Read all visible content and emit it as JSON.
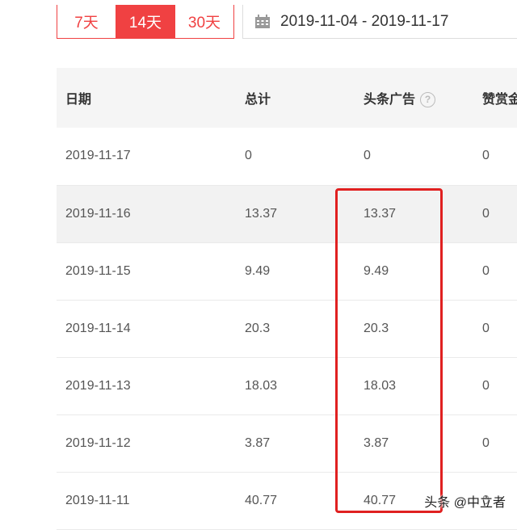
{
  "range_buttons": [
    {
      "label": "7天",
      "active": false
    },
    {
      "label": "14天",
      "active": true
    },
    {
      "label": "30天",
      "active": false
    }
  ],
  "date_range": {
    "icon": "calendar-icon",
    "value": "2019-11-04 - 2019-11-17"
  },
  "table": {
    "headers": [
      "日期",
      "总计",
      "头条广告",
      "赞赏金"
    ],
    "help_icon": "question-circle-icon",
    "rows": [
      [
        "2019-11-17",
        "0",
        "0",
        "0"
      ],
      [
        "2019-11-16",
        "13.37",
        "13.37",
        "0"
      ],
      [
        "2019-11-15",
        "9.49",
        "9.49",
        "0"
      ],
      [
        "2019-11-14",
        "20.3",
        "20.3",
        "0"
      ],
      [
        "2019-11-13",
        "18.03",
        "18.03",
        "0"
      ],
      [
        "2019-11-12",
        "3.87",
        "3.87",
        "0"
      ],
      [
        "2019-11-11",
        "40.77",
        "40.77",
        "0"
      ]
    ]
  },
  "highlight_color": "#e02020",
  "accent_color": "#f04142",
  "watermark": "头条 @中立者"
}
